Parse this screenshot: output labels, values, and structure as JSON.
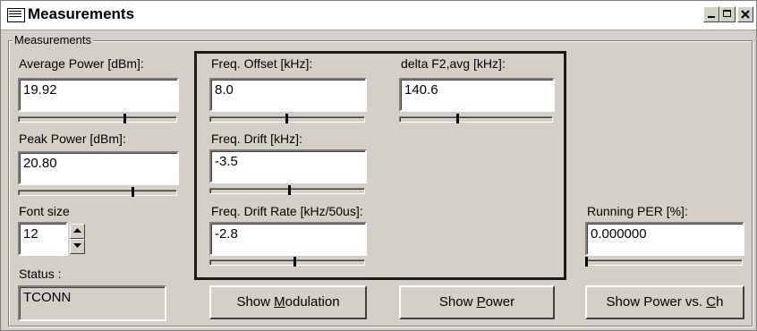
{
  "window": {
    "title": "Measurements",
    "controls": {
      "minimize": "minimize",
      "maximize": "maximize",
      "close": "close"
    }
  },
  "group": {
    "label": "Measurements"
  },
  "fields": {
    "average_power": {
      "label": "Average Power [dBm]:",
      "value": "19.92",
      "slider_level": 0.68
    },
    "peak_power": {
      "label": "Peak Power [dBm]:",
      "value": "20.80",
      "slider_level": 0.73
    },
    "freq_offset": {
      "label": "Freq. Offset [kHz]:",
      "value": "8.0",
      "slider_level": 0.5
    },
    "delta_f2_avg": {
      "label": "delta F2,avg [kHz]:",
      "value": "140.6",
      "slider_level": 0.38
    },
    "freq_drift": {
      "label": "Freq. Drift [kHz]:",
      "value": "-3.5",
      "slider_level": 0.52
    },
    "freq_drift_rate": {
      "label": "Freq. Drift Rate [kHz/50us]:",
      "value": "-2.8",
      "slider_level": 0.55
    },
    "running_per": {
      "label": "Running PER [%]:",
      "value": "0.000000",
      "slider_level": 0.0
    }
  },
  "font_size": {
    "label": "Font size",
    "value": "12"
  },
  "status": {
    "label": "Status :",
    "value": "TCONN"
  },
  "buttons": {
    "show_modulation": {
      "pre": "Show ",
      "accel": "M",
      "post": "odulation"
    },
    "show_power": {
      "pre": "Show ",
      "accel": "P",
      "post": "ower"
    },
    "show_power_vs_ch": {
      "pre": "Show Power vs. ",
      "accel": "C",
      "post": "h"
    }
  }
}
